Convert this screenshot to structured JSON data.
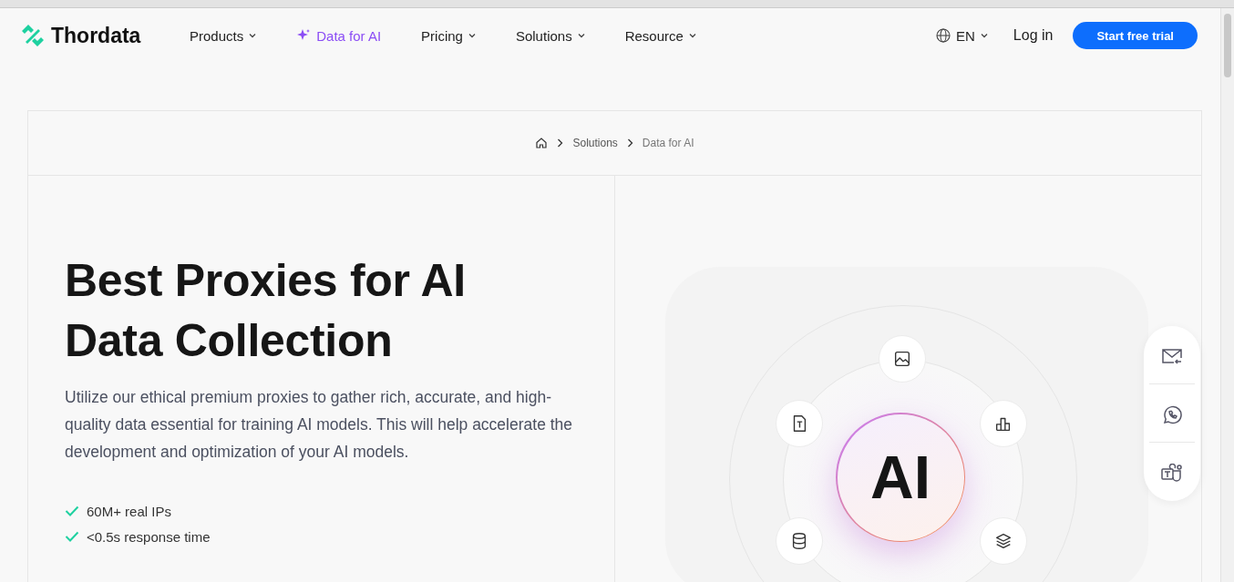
{
  "header": {
    "logo": "Thordata",
    "nav": [
      {
        "label": "Products",
        "selected": false,
        "dropdown": true
      },
      {
        "label": "Data for AI",
        "selected": true,
        "dropdown": false
      },
      {
        "label": "Pricing",
        "selected": false,
        "dropdown": true
      },
      {
        "label": "Solutions",
        "selected": false,
        "dropdown": true
      },
      {
        "label": "Resource",
        "selected": false,
        "dropdown": true
      }
    ],
    "language": "EN",
    "login": "Log in",
    "cta": "Start free trial"
  },
  "breadcrumb": [
    "Solutions",
    "Data for AI"
  ],
  "hero": {
    "title": "Best Proxies for AI Data Collection",
    "description": "Utilize our ethical premium proxies to gather rich, accurate, and high-quality data essential for training AI models. This will help accelerate the development and optimization of your AI models.",
    "features": [
      "60M+ real IPs",
      "<0.5s response time"
    ]
  },
  "illustration": {
    "center": "AI"
  }
}
